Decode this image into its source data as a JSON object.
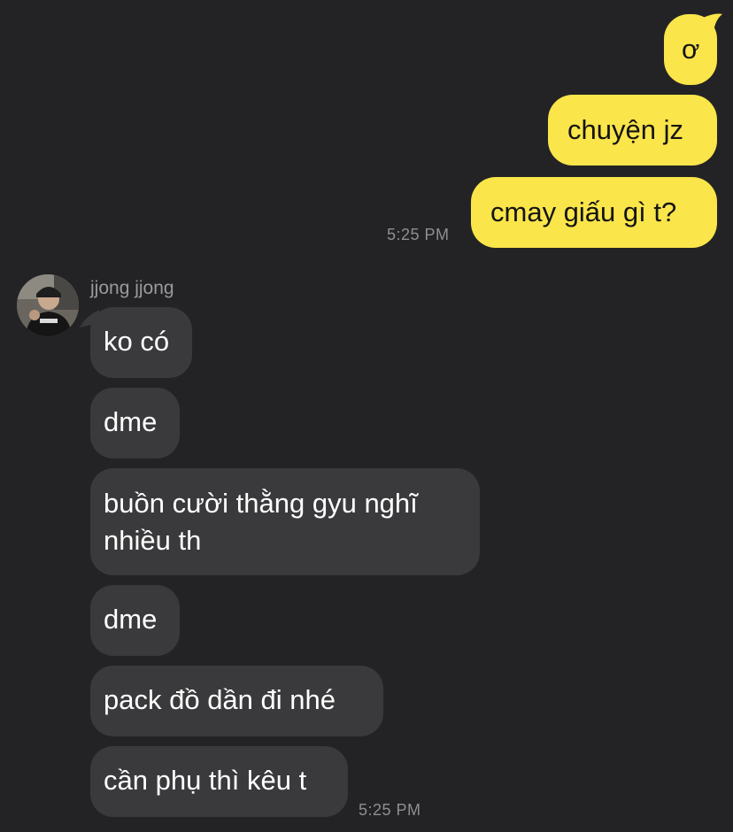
{
  "conversation": {
    "outgoing": [
      {
        "text": "ơ"
      },
      {
        "text": "chuyện jz"
      },
      {
        "text": "cmay giấu gì t?"
      }
    ],
    "outgoing_time": "5:25 PM",
    "sender_name": "jjong jjong",
    "incoming": [
      {
        "text": "ko có"
      },
      {
        "text": "dme"
      },
      {
        "text": "buồn cười thằng gyu nghĩ",
        "text2": "nhiều th"
      },
      {
        "text": "dme"
      },
      {
        "text": "pack đồ dần đi nhé"
      },
      {
        "text": "cần phụ thì kêu t"
      }
    ],
    "incoming_time": "5:25 PM"
  },
  "colors": {
    "background": "#232325",
    "outgoing_bubble": "#fae54a",
    "incoming_bubble": "#3a3a3c",
    "timestamp": "#8e8e93"
  },
  "icons": {
    "avatar": "profile-photo-avatar"
  }
}
